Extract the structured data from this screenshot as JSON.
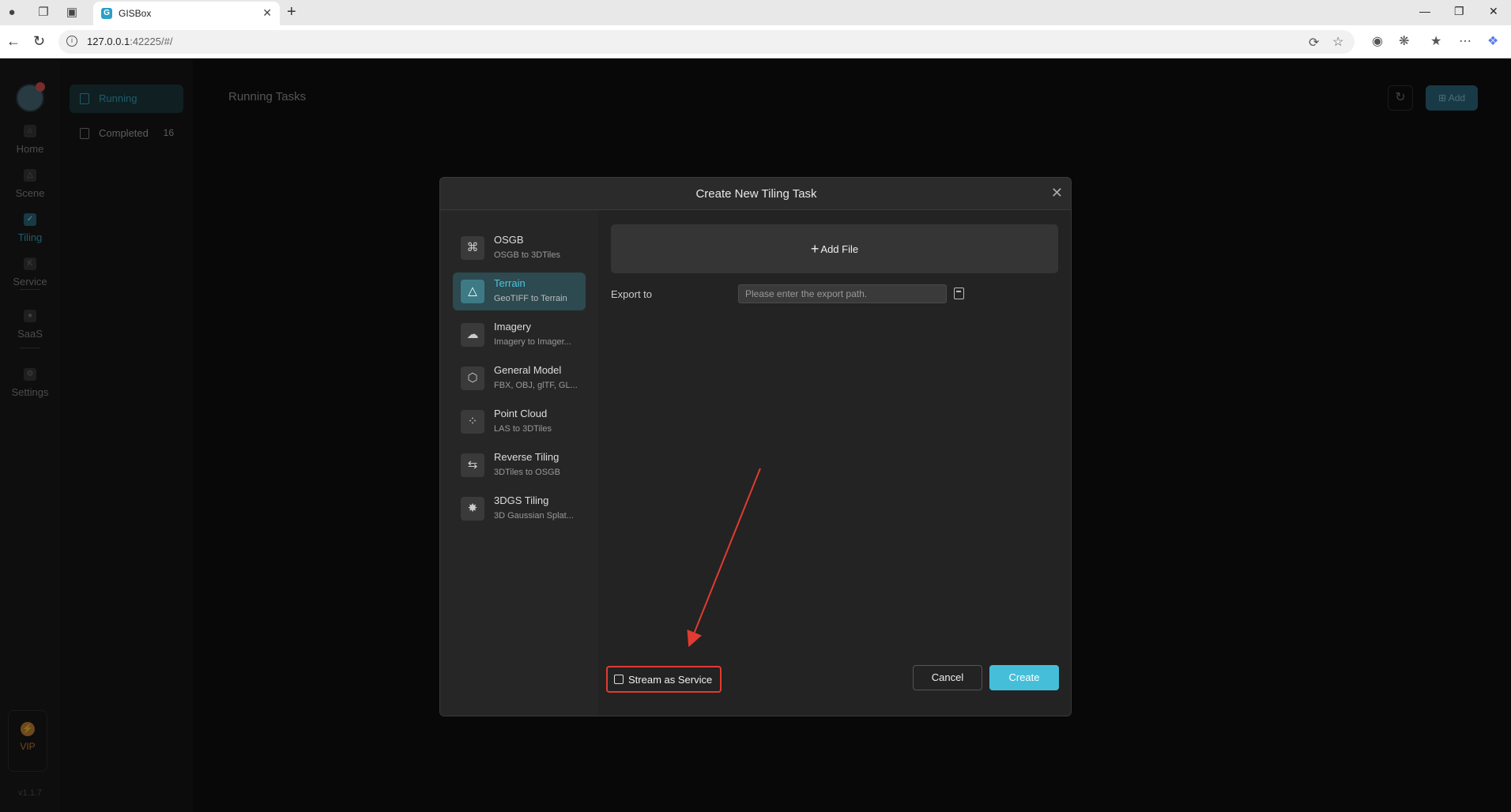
{
  "browser": {
    "tab_title": "GISBox",
    "url_host": "127.0.0.1",
    "url_rest": ":42225/#/"
  },
  "sidebar": {
    "items": [
      {
        "label": "Home",
        "icon": "home-icon"
      },
      {
        "label": "Scene",
        "icon": "scene-icon"
      },
      {
        "label": "Tiling",
        "icon": "tiling-icon",
        "active": true
      },
      {
        "label": "Service",
        "icon": "service-icon"
      },
      {
        "label": "SaaS",
        "icon": "lock-icon"
      },
      {
        "label": "Settings",
        "icon": "gear-icon"
      }
    ],
    "vip_label": "VIP",
    "version": "v1.1.7"
  },
  "subnav": {
    "running_label": "Running",
    "completed_label": "Completed",
    "completed_count": "16"
  },
  "header": {
    "title": "Running Tasks",
    "add_label": "Add"
  },
  "modal": {
    "title": "Create New Tiling Task",
    "types": [
      {
        "name": "OSGB",
        "desc": "OSGB to 3DTiles",
        "icon": "osgb-icon"
      },
      {
        "name": "Terrain",
        "desc": "GeoTIFF to Terrain",
        "icon": "terrain-icon",
        "active": true
      },
      {
        "name": "Imagery",
        "desc": "Imagery to Imager...",
        "icon": "imagery-icon"
      },
      {
        "name": "General Model",
        "desc": "FBX, OBJ, glTF, GL...",
        "icon": "cube-icon"
      },
      {
        "name": "Point Cloud",
        "desc": "LAS to 3DTiles",
        "icon": "point-cloud-icon"
      },
      {
        "name": "Reverse Tiling",
        "desc": "3DTiles to OSGB",
        "icon": "reverse-icon"
      },
      {
        "name": "3DGS Tiling",
        "desc": "3D Gaussian Splat...",
        "icon": "gaussian-icon"
      }
    ],
    "add_file_label": "Add File",
    "export_label": "Export to",
    "export_placeholder": "Please enter the export path.",
    "stream_label": "Stream as Service",
    "cancel_label": "Cancel",
    "create_label": "Create"
  },
  "colors": {
    "accent": "#45bfd9",
    "highlight_box": "#e03c31"
  }
}
